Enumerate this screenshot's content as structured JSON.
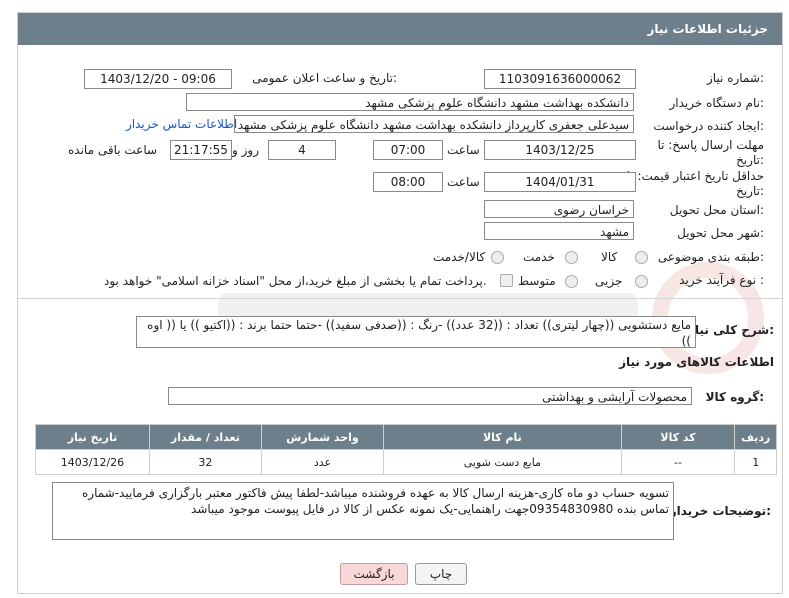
{
  "header": {
    "title": "جزئیات اطلاعات نیاز"
  },
  "fields": {
    "need_number_label": "شماره نیاز:",
    "need_number": "1103091636000062",
    "announce_label": "تاریخ و ساعت اعلان عمومی:",
    "announce_value": "1403/12/20 - 09:06",
    "buyer_org_label": "نام دستگاه خریدار:",
    "buyer_org": "دانشکده بهداشت مشهد   دانشگاه علوم پزشکی مشهد",
    "creator_label": "ایجاد کننده درخواست:",
    "creator": "سیدعلی جعفری کارپرداز دانشکده بهداشت مشهد   دانشگاه علوم پزشکی مشهد",
    "contact_link": "اطلاعات تماس خریدار",
    "deadline_label": "مهلت ارسال پاسخ: تا تاریخ:",
    "deadline_date": "1403/12/25",
    "time_label": "ساعت",
    "deadline_time": "07:00",
    "days": "4",
    "days_label": "روز و",
    "remaining_time": "21:17:55",
    "remaining_label": "ساعت باقی مانده",
    "validity_label": "حداقل تاریخ اعتبار قیمت: تا تاریخ:",
    "validity_date": "1404/01/31",
    "validity_time": "08:00",
    "province_label": "استان محل تحویل:",
    "province": "خراسان رضوی",
    "city_label": "شهر محل تحویل:",
    "city": "مشهد",
    "category_label": "طبقه بندی موضوعی:",
    "category_options": [
      "کالا",
      "خدمت",
      "کالا/خدمت"
    ],
    "process_label": "نوع فرآیند خرید :",
    "process_options": [
      "جزیی",
      "متوسط"
    ],
    "payment_note": "پرداخت تمام یا بخشی از مبلغ خرید،از محل \"اسناد خزانه اسلامی\" خواهد بود."
  },
  "description": {
    "label": "شرح کلی نیاز:",
    "text": "مایع دستشویی ((چهار لیتری)) تعداد : ((32 عدد)) -رنگ : ((صدفی سفید)) -حتما حتما برند : ((اکتیو )) یا (( اوه ))"
  },
  "goods_section_title": "اطلاعات کالاهای مورد نیاز",
  "goods_group": {
    "label": "گروه کالا:",
    "value": "محصولات آرایشی و بهداشتی"
  },
  "table": {
    "headers": [
      "ردیف",
      "کد کالا",
      "نام کالا",
      "واحد شمارش",
      "تعداد / مقدار",
      "تاریخ نیاز"
    ],
    "rows": [
      {
        "row": "1",
        "code": "--",
        "name": "مایع دست شویی",
        "unit": "عدد",
        "qty": "32",
        "date": "1403/12/26"
      }
    ]
  },
  "buyer_notes": {
    "label": "توضیحات خریدار:",
    "text": "تسویه حساب دو ماه کاری-هزینه ارسال کالا به عهده فروشنده میباشد-لطفا پیش فاکتور معتبر بارگزاری فرمایید-شماره تماس بنده 09354830980جهت راهنمایی-یک نمونه عکس از کالا در فایل پیوست موجود میباشد"
  },
  "buttons": {
    "print": "چاپ",
    "back": "بازگشت"
  },
  "colors": {
    "header_bg": "#6d7f8b",
    "link": "#1a56c4",
    "back_btn_bg": "#f7d7d7"
  }
}
